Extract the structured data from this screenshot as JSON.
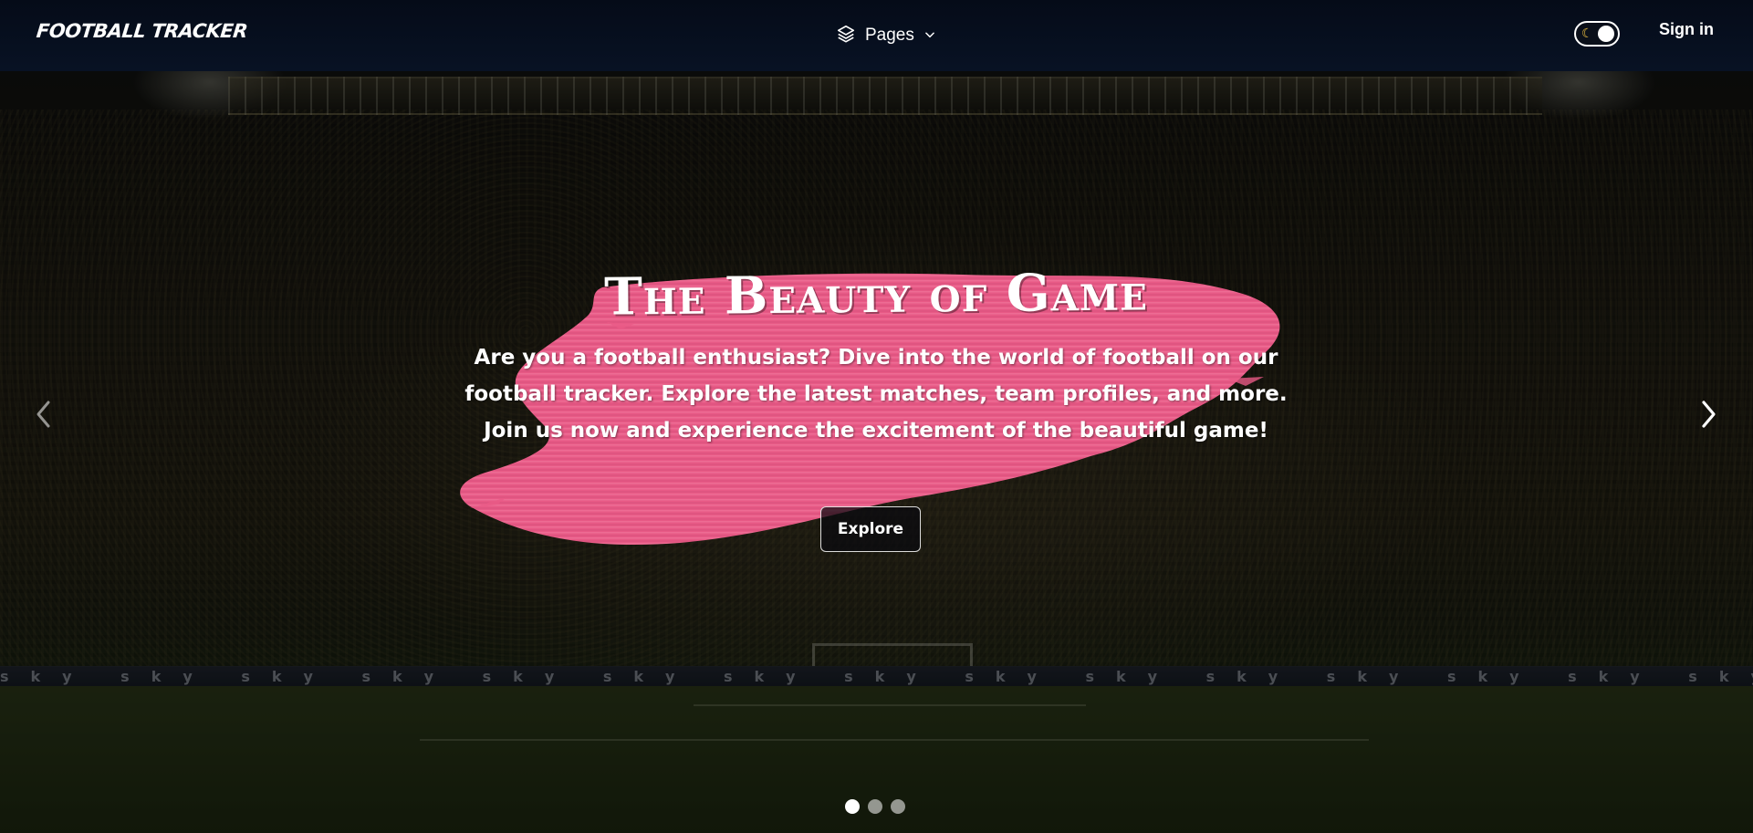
{
  "navbar": {
    "brand": "FOOTBALL TRACKER",
    "pages_menu": {
      "label": "Pages",
      "icon": "layers-icon",
      "caret_icon": "chevron-down-icon"
    },
    "theme_toggle": {
      "icon": "moon-icon",
      "state": "dark"
    },
    "sign_in": "Sign in"
  },
  "hero": {
    "title": "The Beauty of Game",
    "description": "Are you a football enthusiast? Dive into the world of football on our football tracker. Explore the latest matches, team profiles, and more. Join us now and experience the excitement of the beautiful game!",
    "cta_label": "Explore",
    "ad_board_text": "sky sky sky sky sky sky sky sky sky sky sky sky sky sky sky sky sky sky sky sky sky sky sky sky sky sky sky sky sky sky sky",
    "brush_color": "#e85a86"
  },
  "carousel": {
    "prev_icon": "chevron-left-icon",
    "next_icon": "chevron-right-icon",
    "slide_count": 3,
    "active_slide": 1
  },
  "colors": {
    "navbar_bg": "#050b18",
    "accent_pink": "#e85a86",
    "text": "#ffffff"
  }
}
